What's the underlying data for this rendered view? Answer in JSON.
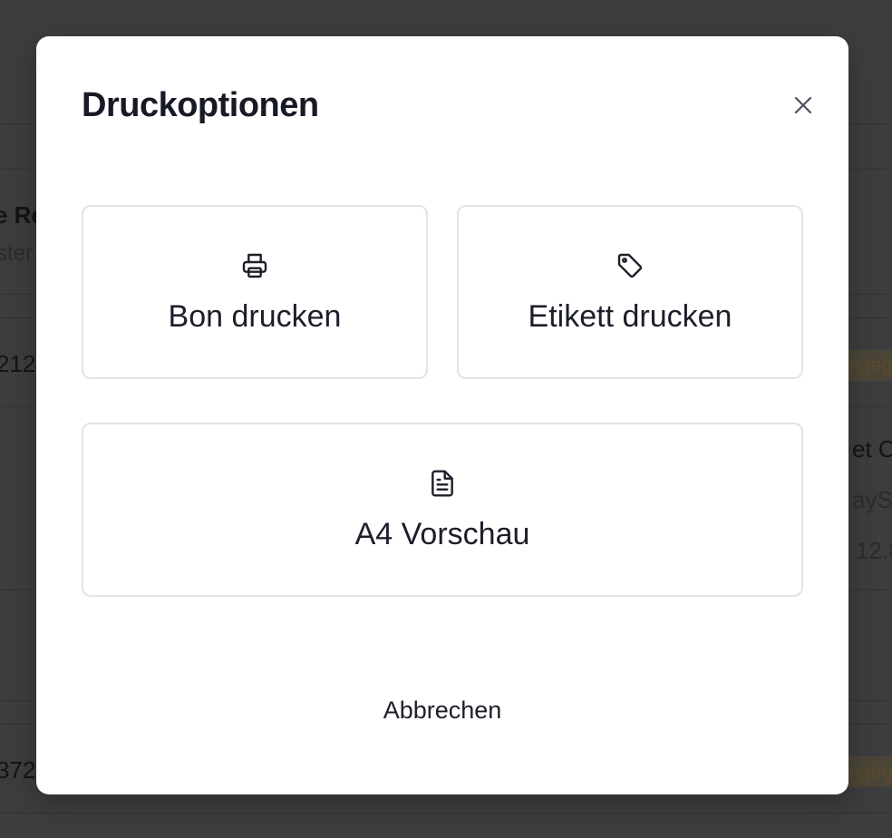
{
  "background": {
    "fragments": {
      "row1_title": "e Re",
      "row1_sub": "ster",
      "row2_id": "212",
      "row2_badge": "ngeg",
      "row3_title": "et C",
      "row3_sub": "aySt",
      "row3_date": "12.8",
      "row4_id": "372",
      "row4_badge": "ngeg"
    }
  },
  "modal": {
    "title": "Druckoptionen",
    "close_icon": "close-icon",
    "options": [
      {
        "label": "Bon drucken",
        "icon": "printer-icon"
      },
      {
        "label": "Etikett drucken",
        "icon": "tag-icon"
      },
      {
        "label": "A4 Vorschau",
        "icon": "document-icon"
      }
    ],
    "cancel_label": "Abbrechen"
  },
  "colors": {
    "overlay": "#3d3d3f",
    "modal_bg": "#ffffff",
    "text": "#1c1f2a",
    "border": "#e1e3e8"
  }
}
